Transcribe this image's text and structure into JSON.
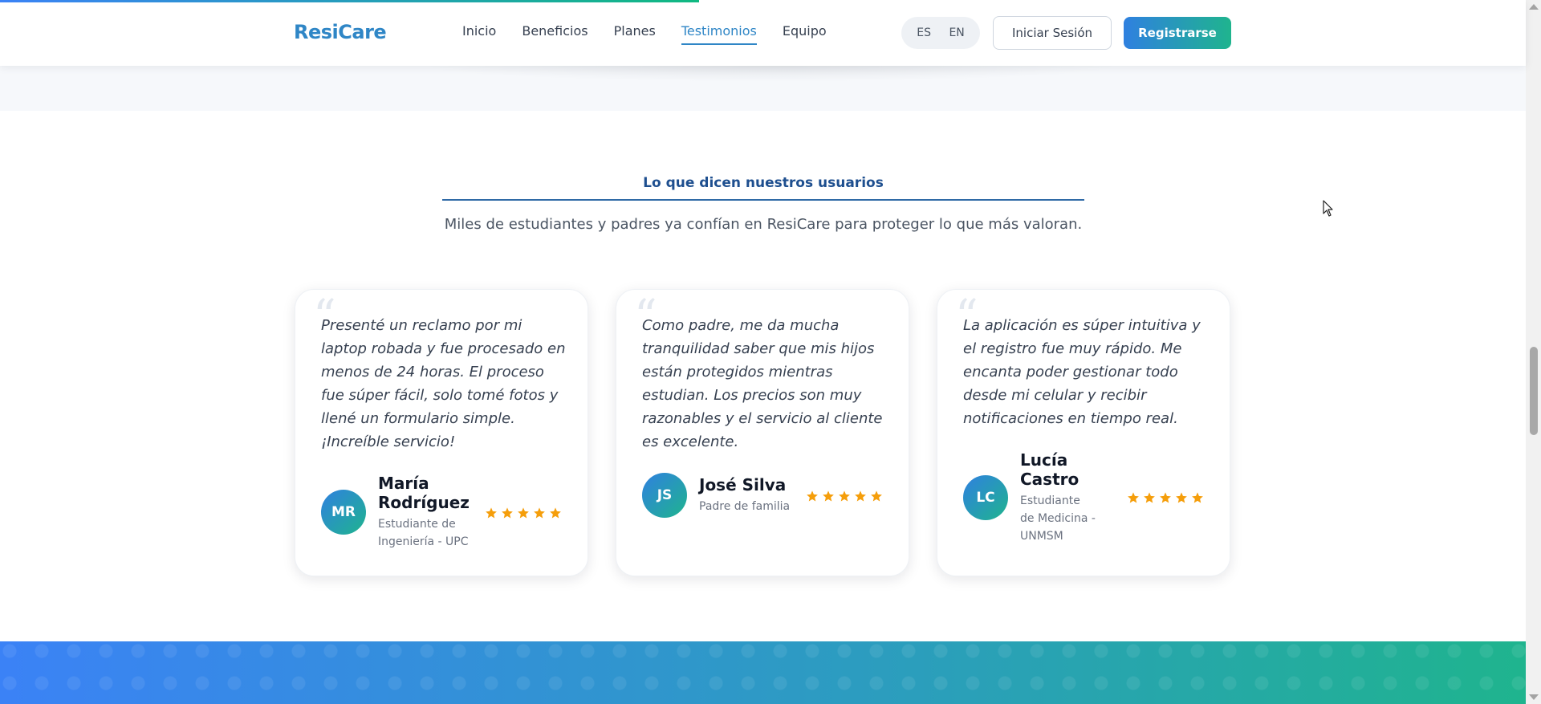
{
  "page": {
    "scroll_progress_percent": 45.8
  },
  "header": {
    "logo": "ResiCare",
    "nav": [
      {
        "label": "Inicio"
      },
      {
        "label": "Beneficios"
      },
      {
        "label": "Planes"
      },
      {
        "label": "Testimonios",
        "active": true
      },
      {
        "label": "Equipo"
      }
    ],
    "languages": [
      "ES",
      "EN"
    ],
    "login_label": "Iniciar Sesión",
    "register_label": "Registrarse"
  },
  "testimonials": {
    "title": "Lo que dicen nuestros usuarios",
    "subtitle": "Miles de estudiantes y padres ya confían en ResiCare para proteger lo que más valoran.",
    "cards": [
      {
        "quote": "Presenté un reclamo por mi laptop robada y fue procesado en menos de 24 horas. El proceso fue súper fácil, solo tomé fotos y llené un formulario simple. ¡Increíble servicio!",
        "initials": "MR",
        "name": "María Rodríguez",
        "role": "Estudiante de Ingeniería - UPC",
        "rating": 5
      },
      {
        "quote": "Como padre, me da mucha tranquilidad saber que mis hijos están protegidos mientras estudian. Los precios son muy razonables y el servicio al cliente es excelente.",
        "initials": "JS",
        "name": "José Silva",
        "role": "Padre de familia",
        "rating": 5
      },
      {
        "quote": "La aplicación es súper intuitiva y el registro fue muy rápido. Me encanta poder gestionar todo desde mi celular y recibir notificaciones en tiempo real.",
        "initials": "LC",
        "name": "Lucía Castro",
        "role": "Estudiante de Medicina - UNMSM",
        "rating": 5
      }
    ]
  },
  "colors": {
    "brand": "#2f86c6",
    "gradient_start": "#2f80e0",
    "gradient_end": "#1fb48e",
    "star": "#f59e0b"
  },
  "icons": {
    "star": "star-icon",
    "quote": "quote-icon",
    "cursor": "mouse-pointer-icon"
  }
}
